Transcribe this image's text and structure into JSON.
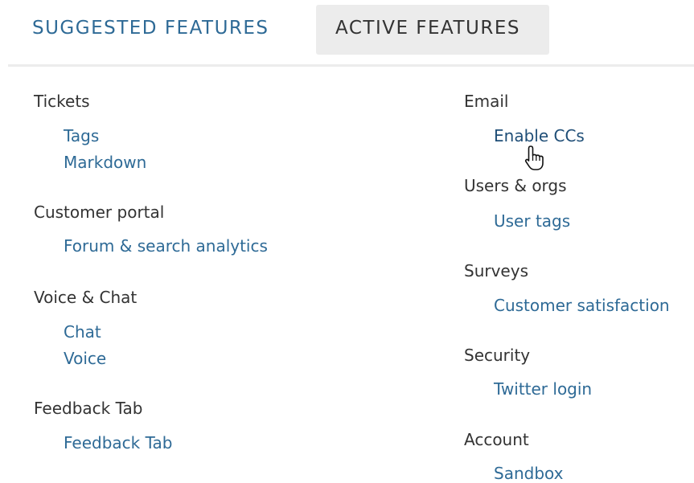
{
  "tabs": {
    "suggested_label": "SUGGESTED FEATURES",
    "active_label": "ACTIVE FEATURES"
  },
  "left_column": {
    "categories": [
      {
        "heading": "Tickets",
        "features": [
          "Tags",
          "Markdown"
        ]
      },
      {
        "heading": "Customer portal",
        "features": [
          "Forum & search analytics"
        ]
      },
      {
        "heading": "Voice & Chat",
        "features": [
          "Chat",
          "Voice"
        ]
      },
      {
        "heading": "Feedback Tab",
        "features": [
          "Feedback Tab"
        ]
      }
    ]
  },
  "right_column": {
    "categories": [
      {
        "heading": "Email",
        "features": [
          "Enable CCs"
        ]
      },
      {
        "heading": "Users & orgs",
        "features": [
          "User tags"
        ]
      },
      {
        "heading": "Surveys",
        "features": [
          "Customer satisfaction"
        ]
      },
      {
        "heading": "Security",
        "features": [
          "Twitter login"
        ]
      },
      {
        "heading": "Account",
        "features": [
          "Sandbox"
        ]
      }
    ]
  },
  "icons": {
    "cursor": "hand-pointer-icon"
  },
  "colors": {
    "link": "#2e6a96",
    "heading": "#333333",
    "active_tab_bg": "#ececec"
  }
}
